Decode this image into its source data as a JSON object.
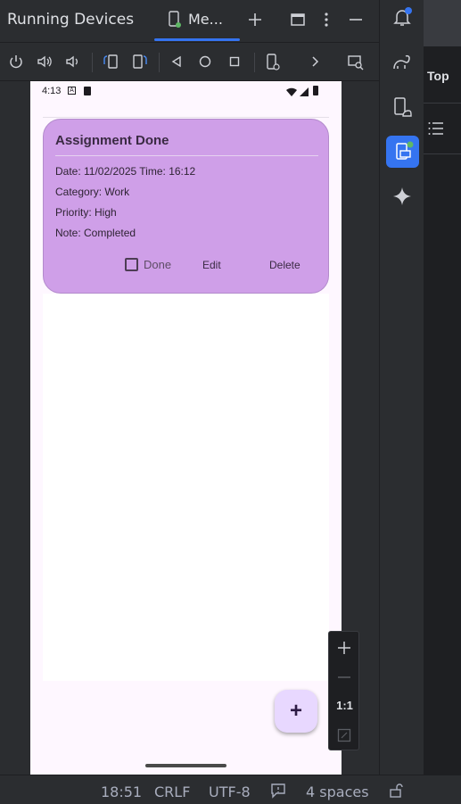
{
  "window": {
    "title": "Running Devices",
    "tab_label": "Me...",
    "icons": [
      "device-tab-icon",
      "add-icon",
      "maximize-icon",
      "more-icon",
      "minimize-icon"
    ]
  },
  "toolbar": {
    "icons": [
      "power-icon",
      "volume-up-icon",
      "volume-down-icon",
      "rotate-left-icon",
      "rotate-right-icon",
      "back-icon",
      "home-icon",
      "overview-icon",
      "device-settings-icon",
      "chevron-right-icon",
      "screen-search-icon"
    ]
  },
  "device": {
    "status_time": "4:13",
    "card": {
      "title": "Assignment Done",
      "date_line": "Date: 11/02/2025  Time: 16:12",
      "category_line": "Category: Work",
      "priority_line": "Priority: High",
      "note_line": "Note: Completed",
      "done_label": "Done",
      "done_checked": false,
      "edit_label": "Edit",
      "delete_label": "Delete",
      "color": "#cf9fe8"
    },
    "fab_label": "+"
  },
  "zoom": {
    "one_to_one": "1:1"
  },
  "right_panel": {
    "top_label": "Top"
  },
  "statusbar": {
    "time": "18:51",
    "line_sep": "CRLF",
    "encoding": "UTF-8",
    "indent": "4 spaces"
  },
  "colors": {
    "accent": "#3574f0",
    "notification_dot": "#3574f0",
    "active_dot": "#5fb865"
  }
}
